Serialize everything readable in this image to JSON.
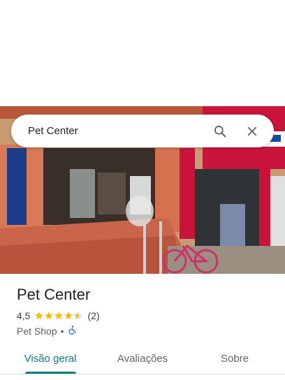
{
  "search": {
    "query": "Pet Center"
  },
  "place": {
    "title": "Pet Center",
    "rating": "4,5",
    "stars": 4.5,
    "reviews": "(2)",
    "category": "Pet Shop",
    "separator": "•"
  },
  "tabs": [
    {
      "label": "Visão geral",
      "active": true
    },
    {
      "label": "Avaliações",
      "active": false
    },
    {
      "label": "Sobre",
      "active": false
    }
  ],
  "colors": {
    "accent": "#0b7c80",
    "star": "#fbbc04",
    "accessibility": "#1a73e8"
  }
}
